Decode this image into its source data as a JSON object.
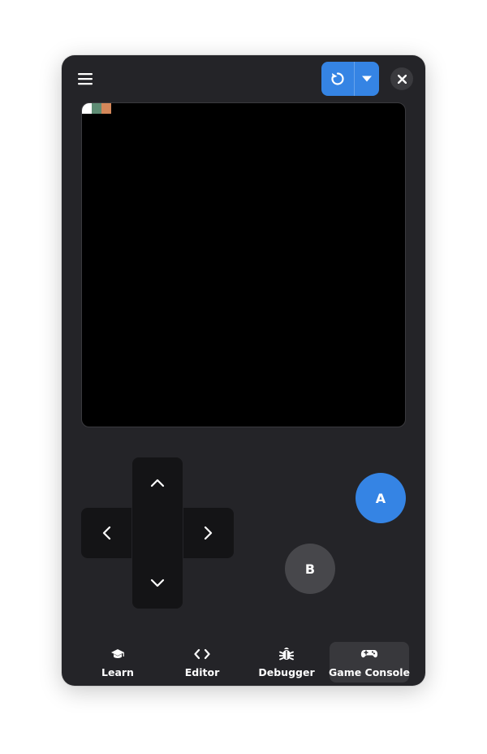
{
  "header": {
    "menu_icon": "hamburger-menu-icon",
    "run_icon": "reload-icon",
    "run_dropdown_icon": "caret-down-icon",
    "close_icon": "close-icon"
  },
  "screen": {
    "pixels": [
      "#ffffff",
      "#5e8c74",
      "#d3875a"
    ]
  },
  "controls": {
    "dpad": [
      "up",
      "left",
      "right",
      "down"
    ],
    "a_label": "A",
    "b_label": "B"
  },
  "nav": {
    "items": [
      {
        "label": "Learn",
        "icon": "graduation-cap-icon"
      },
      {
        "label": "Editor",
        "icon": "code-icon"
      },
      {
        "label": "Debugger",
        "icon": "bug-icon"
      },
      {
        "label": "Game Console",
        "icon": "gamepad-icon",
        "active": true
      }
    ]
  },
  "colors": {
    "window_bg": "#242428",
    "accent": "#3584e4",
    "b_button": "#47474b",
    "dpad": "#141416",
    "active_tab": "#38383c"
  }
}
